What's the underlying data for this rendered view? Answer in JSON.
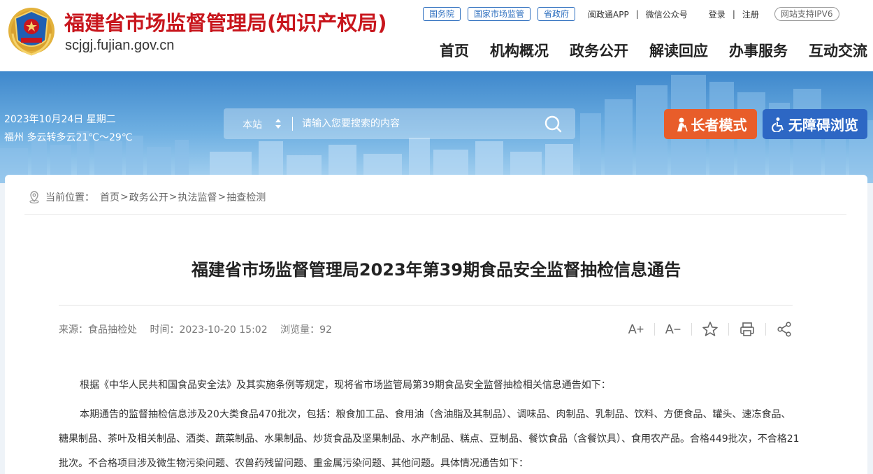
{
  "header": {
    "site_title": "福建省市场监督管理局(知识产权局)",
    "site_domain": "scjgj.fujian.gov.cn",
    "top_links_boxed": [
      "国务院",
      "国家市场监管",
      "省政府"
    ],
    "app_link": "闽政通APP",
    "wechat_link": "微信公众号",
    "login": "登录",
    "separator": "|",
    "register": "注册",
    "ipv6": "网站支持IPV6",
    "nav": [
      "首页",
      "机构概况",
      "政务公开",
      "解读回应",
      "办事服务",
      "互动交流"
    ]
  },
  "banner": {
    "date": "2023年10月24日 星期二",
    "weather": "福州 多云转多云21℃～29℃",
    "search_scope": "本站",
    "search_placeholder": "请输入您要搜索的内容",
    "elder_mode": "长者模式",
    "accessible": "无障碍浏览"
  },
  "breadcrumb": {
    "prefix": "当前位置：",
    "items": [
      "首页",
      "政务公开",
      "执法监督",
      "抽查检测"
    ],
    "sep": ">"
  },
  "article": {
    "title": "福建省市场监督管理局2023年第39期食品安全监督抽检信息通告",
    "source": "来源：食品抽检处",
    "time": "时间：2023-10-20 15:02",
    "views": "浏览量：92",
    "tools": {
      "font_up": "A+",
      "font_down": "A−"
    },
    "paragraphs": [
      "根据《中华人民共和国食品安全法》及其实施条例等规定，现将省市场监管局第39期食品安全监督抽检相关信息通告如下：",
      "本期通告的监督抽检信息涉及20大类食品470批次，包括：粮食加工品、食用油（含油脂及其制品）、调味品、肉制品、乳制品、饮料、方便食品、罐头、速冻食品、糖果制品、茶叶及相关制品、酒类、蔬菜制品、水果制品、炒货食品及坚果制品、水产制品、糕点、豆制品、餐饮食品（含餐饮具）、食用农产品。合格449批次，不合格21批次。不合格项目涉及微生物污染问题、农兽药残留问题、重金属污染问题、其他问题。具体情况通告如下："
    ]
  },
  "colors": {
    "brand_red": "#c8161d",
    "link_blue": "#2e6fbf",
    "elder_orange": "#e85d2a",
    "access_blue": "#2d67c4"
  }
}
